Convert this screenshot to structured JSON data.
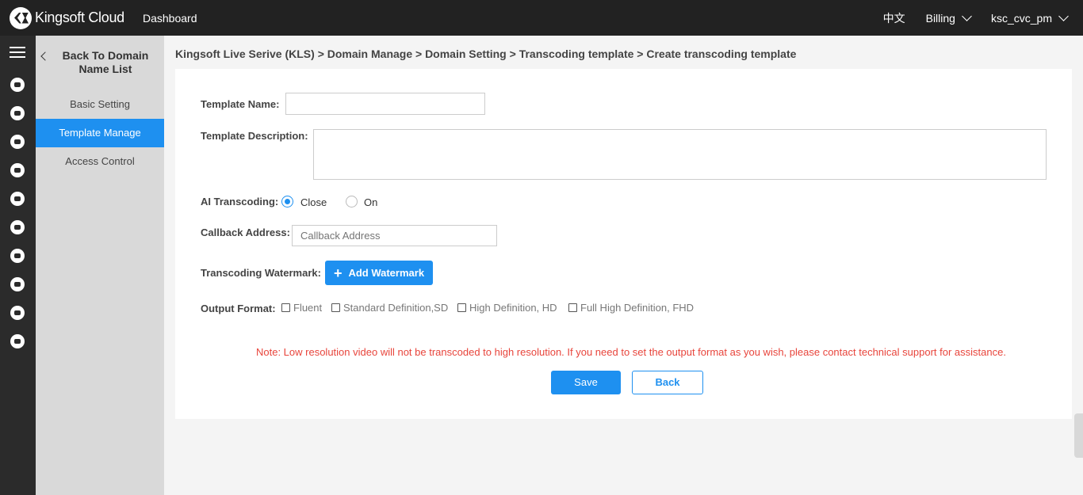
{
  "topbar": {
    "logo_text": "Kingsoft Cloud",
    "dashboard_label": "Dashboard",
    "language_label": "中文",
    "billing_label": "Billing",
    "user_label": "ksc_cvc_pm"
  },
  "rail": {
    "icons": [
      "menu-icon",
      "cloud-icon",
      "server-icon",
      "network-icon",
      "database-icon",
      "monitor-icon",
      "share-icon",
      "storage-icon",
      "stack-icon",
      "upload-cloud-icon",
      "list-icon"
    ]
  },
  "sidebar": {
    "back_label": "Back To Domain Name List",
    "items": [
      {
        "label": "Basic Setting"
      },
      {
        "label": "Template Manage"
      },
      {
        "label": "Access Control"
      }
    ],
    "active_index": 1
  },
  "breadcrumb": "Kingsoft Live Serive (KLS) > Domain Manage > Domain Setting > Transcoding template > Create transcoding template",
  "form": {
    "template_name_label": "Template Name:",
    "template_name_value": "",
    "template_description_label": "Template Description:",
    "template_description_value": "",
    "ai_transcoding_label": "AI Transcoding:",
    "ai_options": [
      {
        "label": "Close"
      },
      {
        "label": "On"
      }
    ],
    "ai_selected": "Close",
    "callback_label": "Callback Address:",
    "callback_placeholder": "Callback Address",
    "watermark_label": "Transcoding Watermark:",
    "add_watermark_label": "Add Watermark",
    "output_format_label": "Output Format:",
    "output_formats": [
      {
        "label": "Fluent"
      },
      {
        "label": "Standard Definition,SD"
      },
      {
        "label": "High Definition, HD"
      },
      {
        "label": "Full High Definition, FHD"
      }
    ],
    "note": "Note: Low resolution video will not be transcoded to high resolution. If you need to set the output format as you wish, please contact technical support for assistance.",
    "save_label": "Save",
    "back_label": "Back"
  },
  "colors": {
    "accent": "#1e90f0",
    "topbar_bg": "#222222",
    "note": "#e8453c"
  }
}
